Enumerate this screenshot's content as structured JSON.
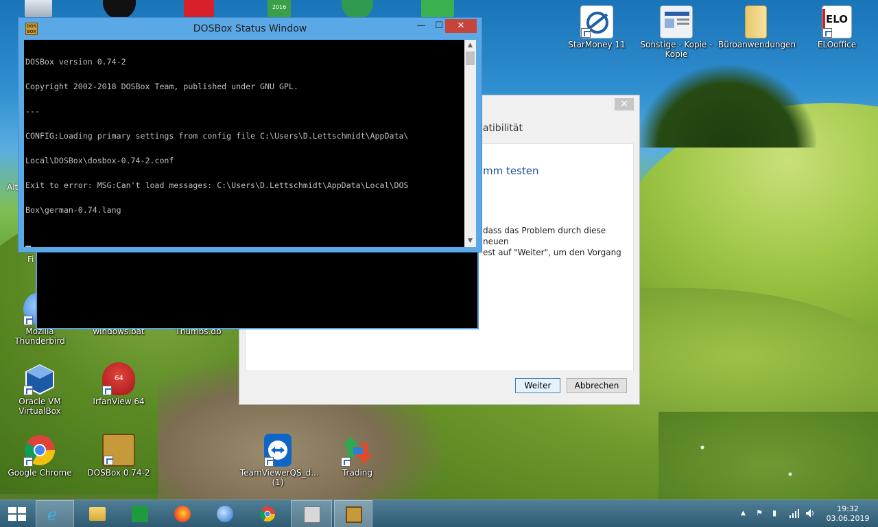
{
  "desktop": {
    "icons_top_right": [
      {
        "label": "StarMoney 11"
      },
      {
        "label": "Sonstige - Kopie - Kopie"
      },
      {
        "label": "Büroanwendungen"
      },
      {
        "label": "ELOoffice"
      }
    ],
    "icons_left": [
      {
        "label": "Mozilla Thunderbird"
      },
      {
        "label": "windows.bat"
      },
      {
        "label": "Thumbs.db"
      },
      {
        "label": "Oracle VM VirtualBox"
      },
      {
        "label": "IrfanView 64"
      },
      {
        "label": "Google Chrome"
      },
      {
        "label": "DOSBox 0.74-2"
      },
      {
        "label": "TeamViewerQS_d... (1)"
      },
      {
        "label": "Trading"
      }
    ],
    "partial_labels": {
      "alt": "Alt",
      "fi": "Fi"
    },
    "elo_badge": "ELO",
    "icon_2016": "2016",
    "irfan_badge": "64"
  },
  "wizard": {
    "header_fragment": "patibilität",
    "title_fragment": "mm testen",
    "text_line1": "dass das Problem durch diese neuen",
    "text_line2": "est auf \"Weiter\", um den Vorgang",
    "next_label": "Weiter",
    "cancel_label": "Abbrechen",
    "close_glyph": "✕"
  },
  "dosbox_window": {
    "title": "DOSBox Status Window",
    "icon_text": "DOS BOX",
    "console_lines": [
      "DOSBox version 0.74-2",
      "Copyright 2002-2018 DOSBox Team, published under GNU GPL.",
      "---",
      "CONFIG:Loading primary settings from config file C:\\Users\\D.Lettschmidt\\AppData\\",
      "Local\\DOSBox\\dosbox-0.74-2.conf",
      "Exit to error: MSG:Can't load messages: C:\\Users\\D.Lettschmidt\\AppData\\Local\\DOS",
      "Box\\german-0.74.lang"
    ],
    "minimize_glyph": "—",
    "maximize_glyph": "☐",
    "close_glyph": "✕"
  },
  "taskbar": {
    "apps": [
      "start",
      "internet-explorer",
      "file-explorer",
      "store",
      "firefox",
      "thunderbird",
      "chrome",
      "scanner",
      "dosbox"
    ],
    "active_app": "dosbox",
    "tray_glyphs": {
      "chevron": "▲",
      "flag": "⚑",
      "network": "▮",
      "volume": "🔊"
    },
    "time": "19:32",
    "date": "03.06.2019"
  }
}
